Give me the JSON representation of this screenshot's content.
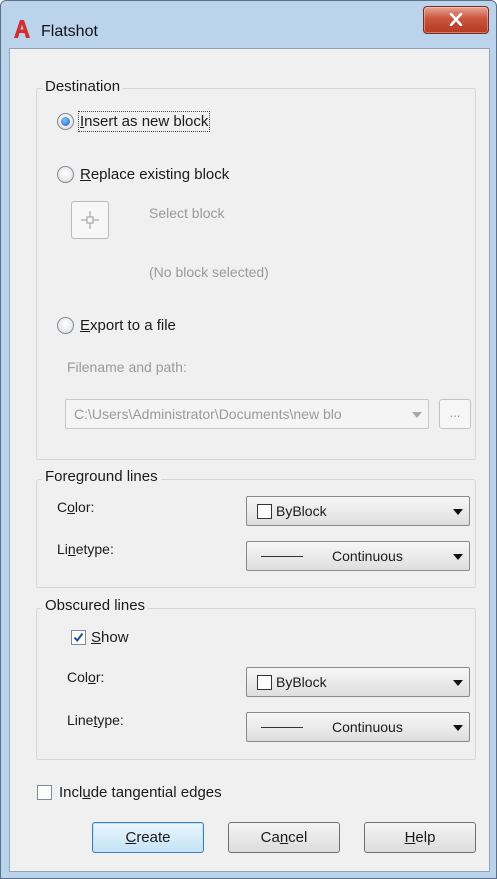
{
  "window": {
    "title": "Flatshot"
  },
  "destination": {
    "group_label": "Destination",
    "insert_option": {
      "pre": "",
      "u": "I",
      "post": "nsert as new block",
      "checked": true
    },
    "replace_option": {
      "pre": "",
      "u": "R",
      "post": "eplace existing block",
      "checked": false
    },
    "select_block_label": "Select block",
    "no_block_selected": "(No block selected)",
    "export_option": {
      "pre": "",
      "u": "E",
      "post": "xport to a file",
      "checked": false
    },
    "filename_label": "Filename and path:",
    "filename_value": "C:\\Users\\Administrator\\Documents\\new blo",
    "browse_label": "..."
  },
  "foreground": {
    "group_label": "Foreground lines",
    "color_label": {
      "pre": "C",
      "u": "o",
      "post": "lor:"
    },
    "color_value": "ByBlock",
    "linetype_label": {
      "pre": "Li",
      "u": "n",
      "post": "etype:"
    },
    "linetype_value": "Continuous"
  },
  "obscured": {
    "group_label": "Obscured lines",
    "show": {
      "pre": "",
      "u": "S",
      "post": "how",
      "checked": true
    },
    "color_label": {
      "pre": "Col",
      "u": "o",
      "post": "r:"
    },
    "color_value": "ByBlock",
    "linetype_label": {
      "pre": "Line",
      "u": "t",
      "post": "ype:"
    },
    "linetype_value": "Continuous"
  },
  "tangential": {
    "pre": "Incl",
    "u": "u",
    "post": "de tangential edges",
    "checked": false
  },
  "buttons": {
    "create": {
      "pre": "",
      "u": "C",
      "post": "reate"
    },
    "cancel": {
      "pre": "Ca",
      "u": "n",
      "post": "cel"
    },
    "help": {
      "pre": "",
      "u": "H",
      "post": "elp"
    }
  },
  "colors": {
    "title_bar": "#bcd3ec",
    "dialog_bg": "#f0f0f0",
    "close_red": "#c9543d",
    "app_icon_red": "#d32f2f"
  }
}
